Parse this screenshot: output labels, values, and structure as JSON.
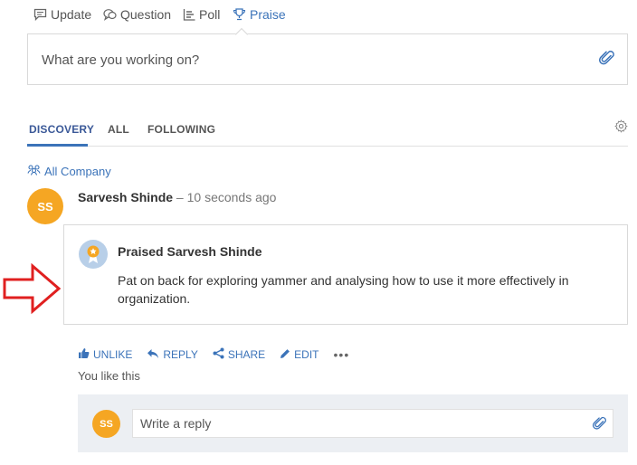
{
  "composer": {
    "tabs": [
      {
        "label": "Update",
        "icon": "update-icon"
      },
      {
        "label": "Question",
        "icon": "question-icon"
      },
      {
        "label": "Poll",
        "icon": "poll-icon"
      },
      {
        "label": "Praise",
        "icon": "trophy-icon",
        "active": true
      }
    ],
    "placeholder": "What are you working on?"
  },
  "feed_tabs": [
    {
      "label": "DISCOVERY",
      "active": true
    },
    {
      "label": "ALL"
    },
    {
      "label": "FOLLOWING"
    }
  ],
  "group": {
    "label": "All Company"
  },
  "post": {
    "author_initials": "SS",
    "author_name": "Sarvesh Shinde",
    "time": " – 10 seconds ago",
    "praise": {
      "title": "Praised Sarvesh Shinde",
      "message": "Pat on back for exploring yammer and analysing how to use it more effectively in organization."
    },
    "actions": {
      "unlike": "UNLIKE",
      "reply": "REPLY",
      "share": "SHARE",
      "edit": "EDIT",
      "more": "•••"
    },
    "likes_text": "You like this"
  },
  "reply": {
    "avatar_initials": "SS",
    "placeholder": "Write a reply"
  },
  "colors": {
    "accent": "#3b73b9",
    "avatar": "#f5a623",
    "annotation_arrow": "#e02020"
  }
}
